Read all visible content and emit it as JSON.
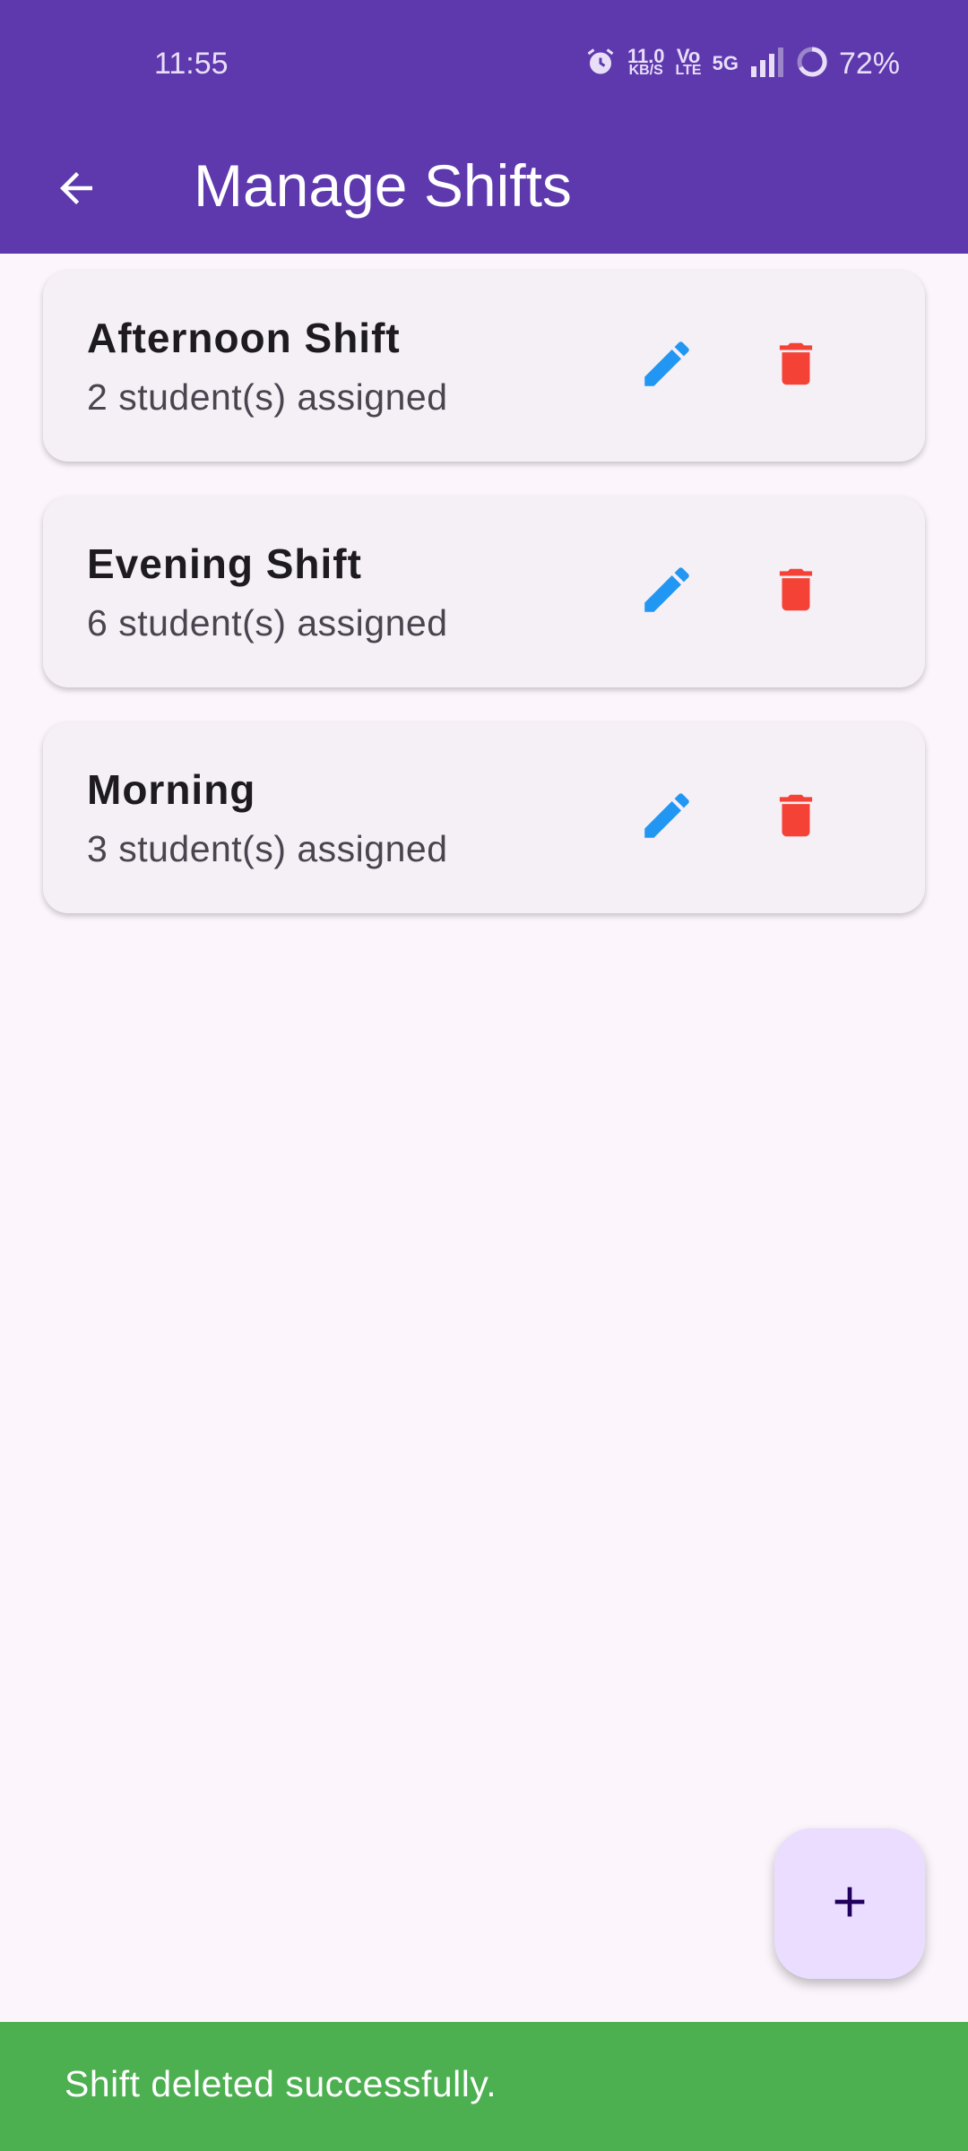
{
  "status_bar": {
    "time": "11:55",
    "net_speed_value": "11.0",
    "net_speed_unit": "KB/S",
    "volte_top": "Vo",
    "volte_bottom": "LTE",
    "network_type": "5G",
    "battery_percent": "72%"
  },
  "app_bar": {
    "title": "Manage Shifts",
    "back_icon": "arrow-back-icon",
    "background": "#5e38ad"
  },
  "shifts": [
    {
      "name": "Afternoon Shift",
      "assigned": "2 student(s) assigned"
    },
    {
      "name": "Evening Shift",
      "assigned": "6 student(s) assigned"
    },
    {
      "name": "Morning",
      "assigned": "3 student(s) assigned"
    }
  ],
  "icons": {
    "edit": "pencil-icon",
    "delete": "trash-icon",
    "add": "plus-icon"
  },
  "colors": {
    "edit": "#2196f3",
    "delete": "#f44336",
    "fab": "#eaddff",
    "snackbar": "#4caf50"
  },
  "snackbar": {
    "message": "Shift deleted successfully."
  }
}
